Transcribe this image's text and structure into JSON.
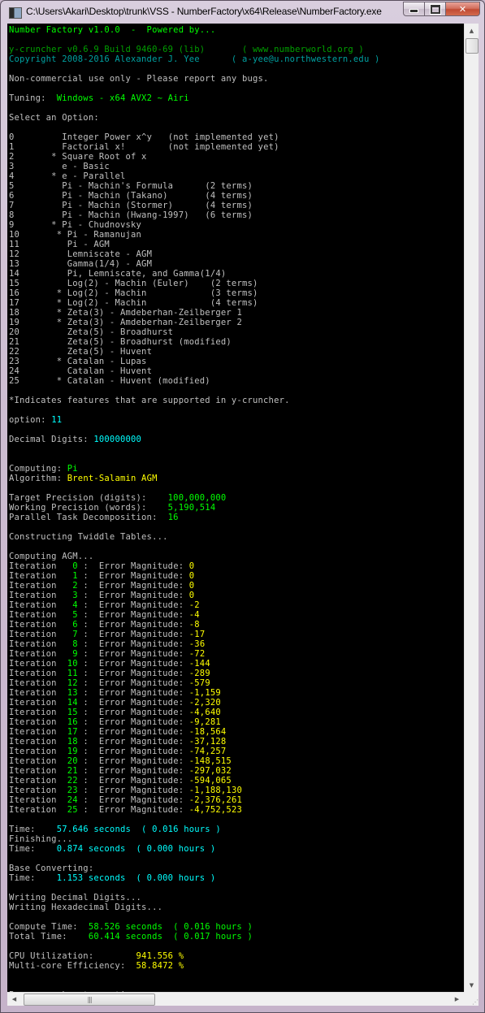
{
  "window": {
    "title": "C:\\Users\\Akari\\Desktop\\trunk\\VSS - NumberFactory\\x64\\Release\\NumberFactory.exe",
    "buttons": {
      "minimize": "minimize",
      "maximize": "maximize",
      "close": "close"
    }
  },
  "header": {
    "app_line": "Number Factory v1.0.0  -  Powered by...",
    "ycruncher_line": "y-cruncher v0.6.9 Build 9460-69 (lib)       ( www.numberworld.org )",
    "copyright_line": "Copyright 2008-2016 Alexander J. Yee      ( a-yee@u.northwestern.edu )",
    "notice": "Non-commercial use only - Please report any bugs.",
    "tuning_label": "Tuning:  ",
    "tuning_value": "Windows - x64 AVX2 ~ Airi",
    "select_prompt": "Select an Option:"
  },
  "menu": {
    "options": [
      {
        "num": "0",
        "star": false,
        "name": "Integer Power x^y",
        "note": "(not implemented yet)"
      },
      {
        "num": "1",
        "star": false,
        "name": "Factorial x!",
        "note": "(not implemented yet)"
      },
      {
        "num": "2",
        "star": true,
        "name": "Square Root of x",
        "note": ""
      },
      {
        "num": "3",
        "star": false,
        "name": "e - Basic",
        "note": ""
      },
      {
        "num": "4",
        "star": true,
        "name": "e - Parallel",
        "note": ""
      },
      {
        "num": "5",
        "star": false,
        "name": "Pi - Machin's Formula",
        "note": "(2 terms)"
      },
      {
        "num": "6",
        "star": false,
        "name": "Pi - Machin (Takano)",
        "note": "(4 terms)"
      },
      {
        "num": "7",
        "star": false,
        "name": "Pi - Machin (Stormer)",
        "note": "(4 terms)"
      },
      {
        "num": "8",
        "star": false,
        "name": "Pi - Machin (Hwang-1997)",
        "note": "(6 terms)"
      },
      {
        "num": "9",
        "star": true,
        "name": "Pi - Chudnovsky",
        "note": ""
      },
      {
        "num": "10",
        "star": true,
        "name": "Pi - Ramanujan",
        "note": ""
      },
      {
        "num": "11",
        "star": false,
        "name": "Pi - AGM",
        "note": ""
      },
      {
        "num": "12",
        "star": false,
        "name": "Lemniscate - AGM",
        "note": ""
      },
      {
        "num": "13",
        "star": false,
        "name": "Gamma(1/4) - AGM",
        "note": ""
      },
      {
        "num": "14",
        "star": false,
        "name": "Pi, Lemniscate, and Gamma(1/4)",
        "note": ""
      },
      {
        "num": "15",
        "star": false,
        "name": "Log(2) - Machin (Euler)",
        "note": "(2 terms)"
      },
      {
        "num": "16",
        "star": true,
        "name": "Log(2) - Machin",
        "note": "(3 terms)"
      },
      {
        "num": "17",
        "star": true,
        "name": "Log(2) - Machin",
        "note": "(4 terms)"
      },
      {
        "num": "18",
        "star": true,
        "name": "Zeta(3) - Amdeberhan-Zeilberger 1",
        "note": ""
      },
      {
        "num": "19",
        "star": true,
        "name": "Zeta(3) - Amdeberhan-Zeilberger 2",
        "note": ""
      },
      {
        "num": "20",
        "star": false,
        "name": "Zeta(5) - Broadhurst",
        "note": ""
      },
      {
        "num": "21",
        "star": false,
        "name": "Zeta(5) - Broadhurst (modified)",
        "note": ""
      },
      {
        "num": "22",
        "star": false,
        "name": "Zeta(5) - Huvent",
        "note": ""
      },
      {
        "num": "23",
        "star": true,
        "name": "Catalan - Lupas",
        "note": ""
      },
      {
        "num": "24",
        "star": false,
        "name": "Catalan - Huvent",
        "note": ""
      },
      {
        "num": "25",
        "star": true,
        "name": "Catalan - Huvent (modified)",
        "note": ""
      }
    ],
    "footnote": "*Indicates features that are supported in y-cruncher."
  },
  "input": {
    "option_label": "option: ",
    "option_value": "11",
    "digits_label": "Decimal Digits: ",
    "digits_value": "100000000"
  },
  "run": {
    "computing_label": "Computing: ",
    "computing_value": "Pi",
    "algorithm_label": "Algorithm: ",
    "algorithm_value": "Brent-Salamin AGM",
    "target_label": "Target Precision (digits):    ",
    "target_value": "100,000,000",
    "working_label": "Working Precision (words):    ",
    "working_value": "5,190,514",
    "parallel_label": "Parallel Task Decomposition:  ",
    "parallel_value": "16",
    "twiddle": "Constructing Twiddle Tables...",
    "agm_header": "Computing AGM...",
    "iteration_label": "Iteration",
    "error_label": "Error Magnitude: ",
    "iterations": [
      {
        "n": "0",
        "err": "0"
      },
      {
        "n": "1",
        "err": "0"
      },
      {
        "n": "2",
        "err": "0"
      },
      {
        "n": "3",
        "err": "0"
      },
      {
        "n": "4",
        "err": "-2"
      },
      {
        "n": "5",
        "err": "-4"
      },
      {
        "n": "6",
        "err": "-8"
      },
      {
        "n": "7",
        "err": "-17"
      },
      {
        "n": "8",
        "err": "-36"
      },
      {
        "n": "9",
        "err": "-72"
      },
      {
        "n": "10",
        "err": "-144"
      },
      {
        "n": "11",
        "err": "-289"
      },
      {
        "n": "12",
        "err": "-579"
      },
      {
        "n": "13",
        "err": "-1,159"
      },
      {
        "n": "14",
        "err": "-2,320"
      },
      {
        "n": "15",
        "err": "-4,640"
      },
      {
        "n": "16",
        "err": "-9,281"
      },
      {
        "n": "17",
        "err": "-18,564"
      },
      {
        "n": "18",
        "err": "-37,128"
      },
      {
        "n": "19",
        "err": "-74,257"
      },
      {
        "n": "20",
        "err": "-148,515"
      },
      {
        "n": "21",
        "err": "-297,032"
      },
      {
        "n": "22",
        "err": "-594,065"
      },
      {
        "n": "23",
        "err": "-1,188,130"
      },
      {
        "n": "24",
        "err": "-2,376,261"
      },
      {
        "n": "25",
        "err": "-4,752,523"
      }
    ],
    "time_label": "Time:    ",
    "agm_time": "57.646 seconds  ( 0.016 hours )",
    "finishing": "Finishing...",
    "finishing_time": "0.874 seconds  ( 0.000 hours )",
    "base_converting": "Base Converting:",
    "base_time": "1.153 seconds  ( 0.000 hours )",
    "writing_decimal": "Writing Decimal Digits...",
    "writing_hex": "Writing Hexadecimal Digits...",
    "compute_time_label": "Compute Time:  ",
    "compute_time_value": "58.526 seconds  ( 0.016 hours )",
    "total_time_label": "Total Time:    ",
    "total_time_value": "60.414 seconds  ( 0.017 hours )",
    "cpu_label": "CPU Utilization:        ",
    "cpu_value": "941.556 %",
    "efficiency_label": "Multi-core Efficiency:  ",
    "efficiency_value": "58.8472 %",
    "press_key": "Press any key to continue . . . "
  },
  "colors": {
    "console_bg": "#000000",
    "default_text": "#c0c0c0",
    "bright_green": "#00ff00",
    "dark_green": "#00a000",
    "teal": "#00a0a0",
    "cyan": "#00ffff",
    "yellow": "#ffff00"
  }
}
